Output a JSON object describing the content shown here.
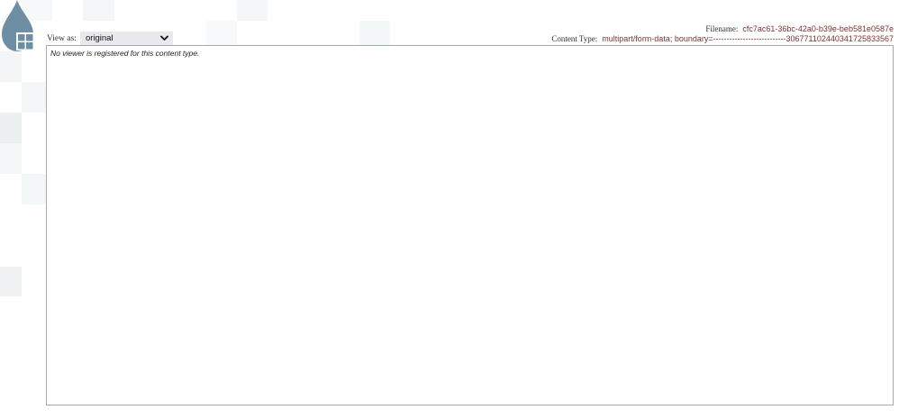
{
  "view_as": {
    "label": "View as:",
    "selected": "original"
  },
  "meta": {
    "filename_label": "Filename:",
    "filename_value": "cfc7ac61-36bc-42a0-b39e-beb581e0587e",
    "content_type_label": "Content Type:",
    "content_type_value": "multipart/form-data; boundary=---------------------------306771102440341725833567"
  },
  "viewer": {
    "message": "No viewer is registered for this content type."
  },
  "colors": {
    "logo": "#6e8fa3",
    "value_text": "#7a3434",
    "viewer_border": "#a9a9a9"
  }
}
